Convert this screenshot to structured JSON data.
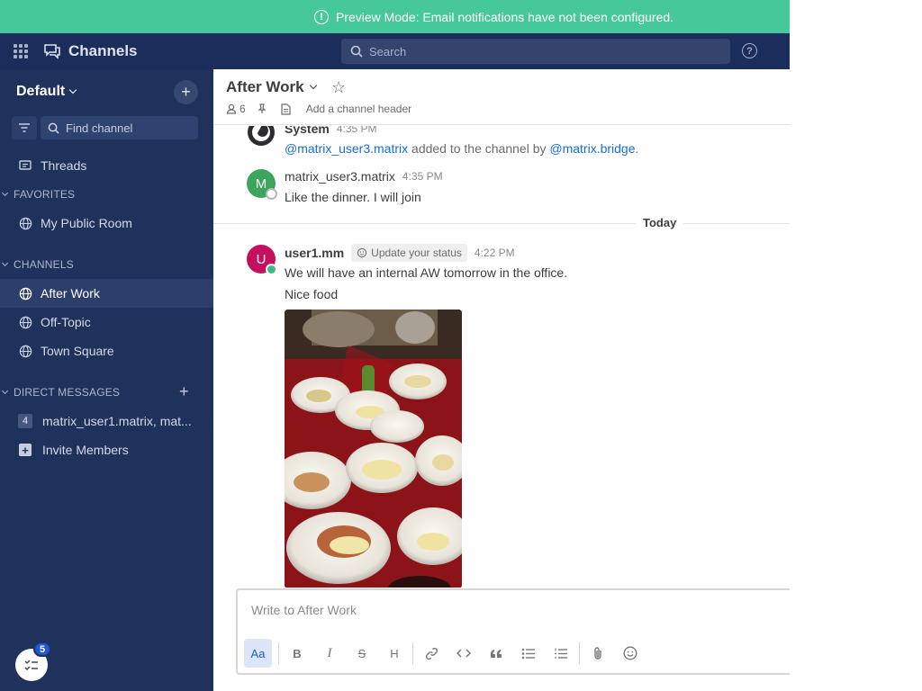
{
  "banner": {
    "text": "Preview Mode: Email notifications have not been configured."
  },
  "topbar": {
    "product_name": "Channels",
    "search_placeholder": "Search"
  },
  "sidebar": {
    "team_name": "Default",
    "find_channel": "Find channel",
    "threads_label": "Threads",
    "favorites_heading": "FAVORITES",
    "favorites": [
      {
        "label": "My Public Room"
      }
    ],
    "channels_heading": "CHANNELS",
    "channels": [
      {
        "label": "After Work",
        "active": true
      },
      {
        "label": "Off-Topic"
      },
      {
        "label": "Town Square"
      }
    ],
    "dm_heading": "DIRECT MESSAGES",
    "dms": [
      {
        "count": "4",
        "label": "matrix_user1.matrix, mat..."
      }
    ],
    "invite_label": "Invite Members",
    "onboarding_badge": "5"
  },
  "channel": {
    "name": "After Work",
    "member_count": "6",
    "header_placeholder": "Add a channel header"
  },
  "posts": [
    {
      "author": "System",
      "time": "4:35 PM",
      "mention1": "@matrix_user3.matrix",
      "mid": " added to the channel by ",
      "mention2": "@matrix.bridge",
      "end": "."
    },
    {
      "author": "matrix_user3.matrix",
      "avatar_letter": "M",
      "time": "4:35 PM",
      "text": "Like the dinner. I will join"
    },
    {
      "author": "user1.mm",
      "avatar_letter": "U",
      "status_chip": "Update your status",
      "time": "4:22 PM",
      "lines": [
        "We will have an internal AW tomorrow in the office.",
        "Nice food"
      ]
    }
  ],
  "date_divider": "Today",
  "composer": {
    "placeholder": "Write to After Work",
    "format_label": "Aa",
    "heading_label": "H"
  },
  "colors": {
    "banner": "#47c89a",
    "topbar": "#1b2d5b",
    "sidebar": "#1e325c",
    "mention": "#166de0",
    "avatar_m": "#3ba55c",
    "avatar_u": "#c4105f",
    "accent": "#1c58d9"
  }
}
